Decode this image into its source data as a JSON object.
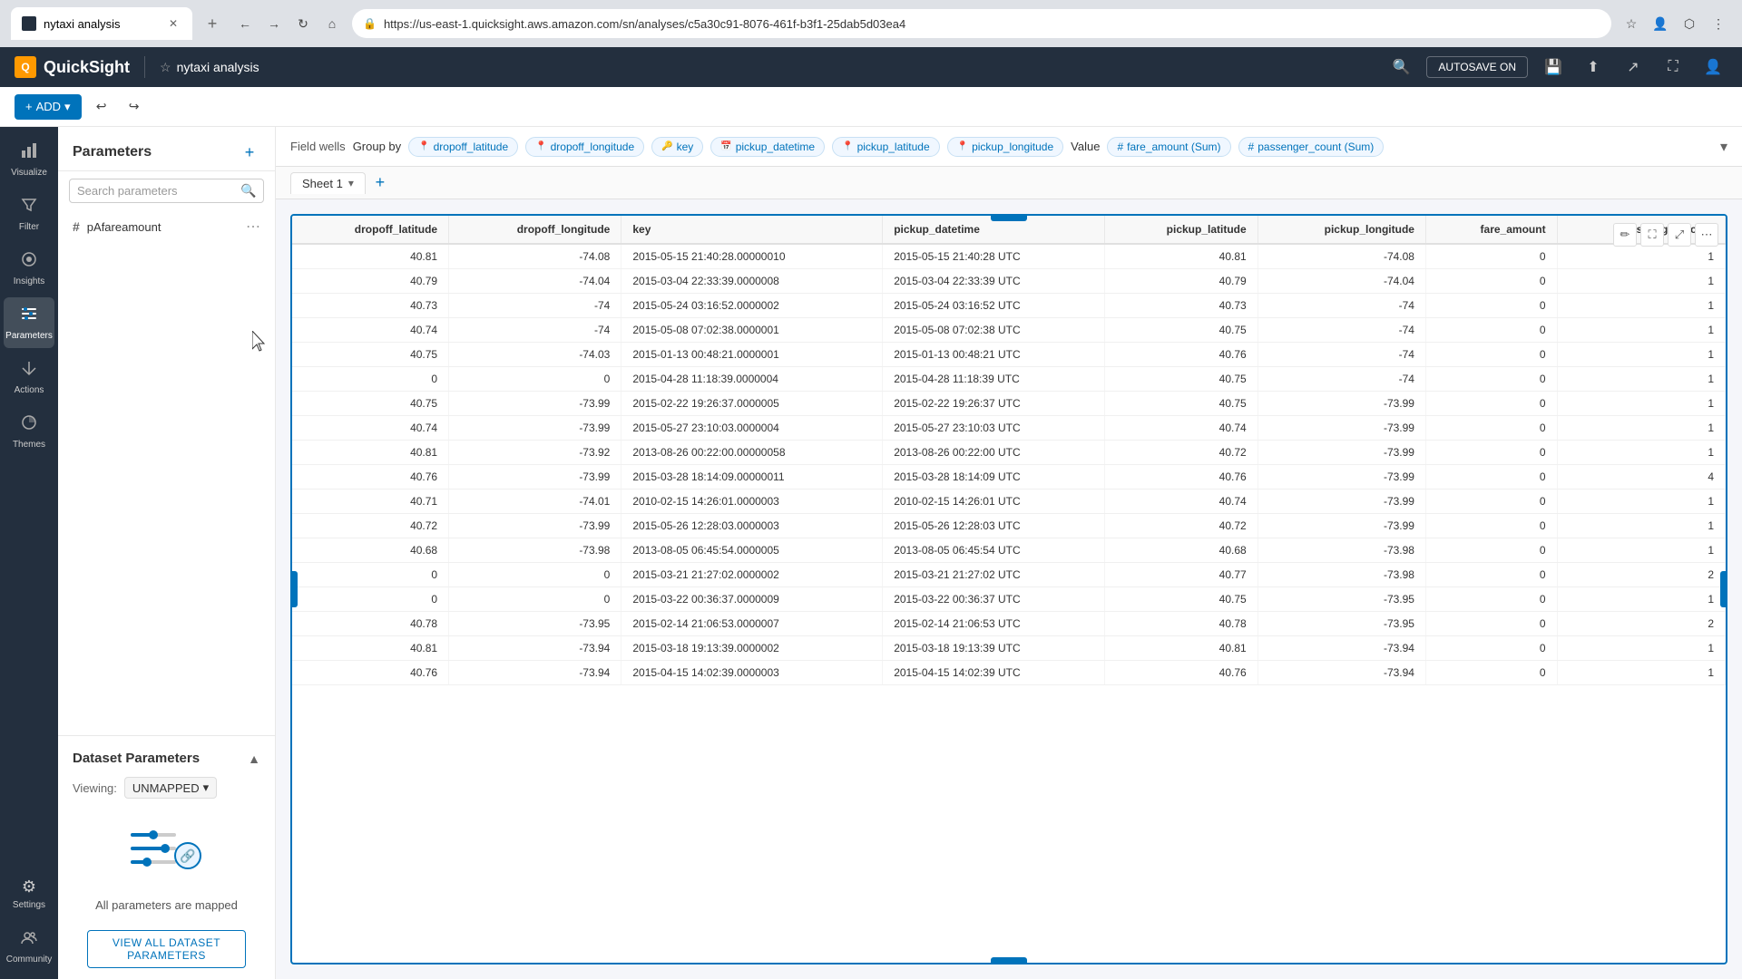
{
  "browser": {
    "tab_title": "nytaxi analysis",
    "url": "https://us-east-1.quicksight.aws.amazon.com/sn/analyses/c5a30c91-8076-461f-b3f1-25dab5d03ea4",
    "zoom": "120%",
    "new_tab_label": "+"
  },
  "app": {
    "logo": "QuickSight",
    "analysis_name": "nytaxi analysis",
    "autosave_label": "AUTOSAVE ON"
  },
  "toolbar": {
    "add_label": "ADD"
  },
  "sidebar": {
    "items": [
      {
        "id": "visualize",
        "label": "Visualize",
        "icon": "📊"
      },
      {
        "id": "filter",
        "label": "Filter",
        "icon": "🔽"
      },
      {
        "id": "insights",
        "label": "Insights",
        "icon": "📍"
      },
      {
        "id": "parameters",
        "label": "Parameters",
        "icon": "⚙"
      },
      {
        "id": "actions",
        "label": "Actions",
        "icon": "⚡"
      },
      {
        "id": "themes",
        "label": "Themes",
        "icon": "🎨"
      },
      {
        "id": "settings",
        "label": "Settings",
        "icon": "⚙️"
      },
      {
        "id": "community",
        "label": "Community",
        "icon": "💬"
      }
    ]
  },
  "parameters_panel": {
    "title": "Parameters",
    "search_placeholder": "Search parameters",
    "add_tooltip": "Add parameter",
    "params": [
      {
        "name": "pAfareamount",
        "type": "hash"
      }
    ]
  },
  "dataset_params": {
    "title": "Dataset Parameters",
    "viewing_label": "Viewing:",
    "viewing_value": "UNMAPPED",
    "mapped_text": "All parameters are mapped",
    "view_button_label": "VIEW ALL DATASET PARAMETERS"
  },
  "field_wells": {
    "label": "Field wells",
    "group_by_label": "Group by",
    "group_fields": [
      {
        "icon": "📍",
        "name": "dropoff_latitude"
      },
      {
        "icon": "📍",
        "name": "dropoff_longitude"
      },
      {
        "icon": "🔑",
        "name": "key"
      },
      {
        "icon": "📅",
        "name": "pickup_datetime"
      },
      {
        "icon": "📍",
        "name": "pickup_latitude"
      },
      {
        "icon": "📍",
        "name": "pickup_longitude"
      }
    ],
    "value_label": "Value",
    "value_fields": [
      {
        "icon": "#",
        "name": "fare_amount (Sum)"
      },
      {
        "icon": "#",
        "name": "passenger_count (Sum)"
      }
    ]
  },
  "sheets": {
    "tabs": [
      {
        "name": "Sheet 1",
        "active": true
      }
    ],
    "add_tooltip": "Add sheet"
  },
  "table": {
    "columns": [
      {
        "id": "dropoff_latitude",
        "label": "dropoff_latitude",
        "align": "right"
      },
      {
        "id": "dropoff_longitude",
        "label": "dropoff_longitude",
        "align": "right"
      },
      {
        "id": "key",
        "label": "key",
        "align": "left"
      },
      {
        "id": "pickup_datetime",
        "label": "pickup_datetime",
        "align": "left"
      },
      {
        "id": "pickup_latitude",
        "label": "pickup_latitude",
        "align": "right"
      },
      {
        "id": "pickup_longitude",
        "label": "pickup_longitude",
        "align": "right"
      },
      {
        "id": "fare_amount",
        "label": "fare_amount",
        "align": "right"
      },
      {
        "id": "passenger_count",
        "label": "passenger_count",
        "align": "right"
      }
    ],
    "rows": [
      [
        "40.81",
        "-74.08",
        "2015-05-15 21:40:28.00000010",
        "2015-05-15 21:40:28 UTC",
        "40.81",
        "-74.08",
        "0",
        "1"
      ],
      [
        "40.79",
        "-74.04",
        "2015-03-04 22:33:39.0000008",
        "2015-03-04 22:33:39 UTC",
        "40.79",
        "-74.04",
        "0",
        "1"
      ],
      [
        "40.73",
        "-74",
        "2015-05-24 03:16:52.0000002",
        "2015-05-24 03:16:52 UTC",
        "40.73",
        "-74",
        "0",
        "1"
      ],
      [
        "40.74",
        "-74",
        "2015-05-08 07:02:38.0000001",
        "2015-05-08 07:02:38 UTC",
        "40.75",
        "-74",
        "0",
        "1"
      ],
      [
        "40.75",
        "-74.03",
        "2015-01-13 00:48:21.0000001",
        "2015-01-13 00:48:21 UTC",
        "40.76",
        "-74",
        "0",
        "1"
      ],
      [
        "0",
        "0",
        "2015-04-28 11:18:39.0000004",
        "2015-04-28 11:18:39 UTC",
        "40.75",
        "-74",
        "0",
        "1"
      ],
      [
        "40.75",
        "-73.99",
        "2015-02-22 19:26:37.0000005",
        "2015-02-22 19:26:37 UTC",
        "40.75",
        "-73.99",
        "0",
        "1"
      ],
      [
        "40.74",
        "-73.99",
        "2015-05-27 23:10:03.0000004",
        "2015-05-27 23:10:03 UTC",
        "40.74",
        "-73.99",
        "0",
        "1"
      ],
      [
        "40.81",
        "-73.92",
        "2013-08-26 00:22:00.00000058",
        "2013-08-26 00:22:00 UTC",
        "40.72",
        "-73.99",
        "0",
        "1"
      ],
      [
        "40.76",
        "-73.99",
        "2015-03-28 18:14:09.00000011",
        "2015-03-28 18:14:09 UTC",
        "40.76",
        "-73.99",
        "0",
        "4"
      ],
      [
        "40.71",
        "-74.01",
        "2010-02-15 14:26:01.0000003",
        "2010-02-15 14:26:01 UTC",
        "40.74",
        "-73.99",
        "0",
        "1"
      ],
      [
        "40.72",
        "-73.99",
        "2015-05-26 12:28:03.0000003",
        "2015-05-26 12:28:03 UTC",
        "40.72",
        "-73.99",
        "0",
        "1"
      ],
      [
        "40.68",
        "-73.98",
        "2013-08-05 06:45:54.0000005",
        "2013-08-05 06:45:54 UTC",
        "40.68",
        "-73.98",
        "0",
        "1"
      ],
      [
        "0",
        "0",
        "2015-03-21 21:27:02.0000002",
        "2015-03-21 21:27:02 UTC",
        "40.77",
        "-73.98",
        "0",
        "2"
      ],
      [
        "0",
        "0",
        "2015-03-22 00:36:37.0000009",
        "2015-03-22 00:36:37 UTC",
        "40.75",
        "-73.95",
        "0",
        "1"
      ],
      [
        "40.78",
        "-73.95",
        "2015-02-14 21:06:53.0000007",
        "2015-02-14 21:06:53 UTC",
        "40.78",
        "-73.95",
        "0",
        "2"
      ],
      [
        "40.81",
        "-73.94",
        "2015-03-18 19:13:39.0000002",
        "2015-03-18 19:13:39 UTC",
        "40.81",
        "-73.94",
        "0",
        "1"
      ],
      [
        "40.76",
        "-73.94",
        "2015-04-15 14:02:39.0000003",
        "2015-04-15 14:02:39 UTC",
        "40.76",
        "-73.94",
        "0",
        "1"
      ]
    ]
  }
}
